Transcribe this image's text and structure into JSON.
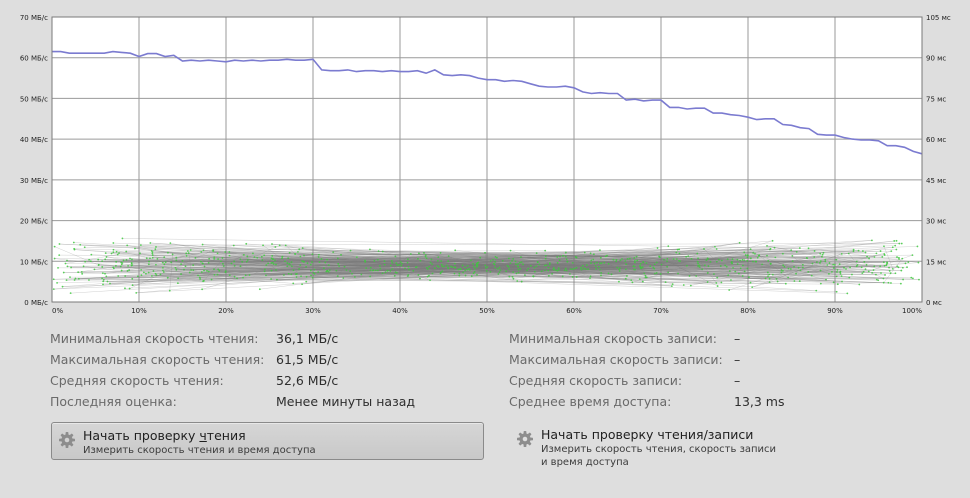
{
  "chart_data": {
    "type": "line",
    "x_unit": "%",
    "y_left": {
      "unit": "МБ/с",
      "ylim": [
        0,
        70
      ],
      "ticks": [
        "0 МБ/с",
        "10 МБ/с",
        "20 МБ/с",
        "30 МБ/с",
        "40 МБ/с",
        "50 МБ/с",
        "60 МБ/с",
        "70 МБ/с"
      ]
    },
    "y_right": {
      "unit": "мс",
      "ylim": [
        0,
        105
      ],
      "ticks": [
        "0 мс",
        "15 мс",
        "30 мс",
        "45 мс",
        "60 мс",
        "75 мс",
        "90 мс",
        "105 мс"
      ]
    },
    "x_ticks": [
      "0%",
      "10%",
      "20%",
      "30%",
      "40%",
      "50%",
      "60%",
      "70%",
      "80%",
      "90%",
      "100%"
    ],
    "grid": true,
    "colors": {
      "read": "#7b7bd0",
      "access": "#3ec93e",
      "access_lines": "#7a7a7a",
      "background": "#ffffff",
      "grid": "#9a9a9a"
    },
    "series": [
      {
        "x": [
          0,
          1,
          2,
          3,
          4,
          5,
          6,
          7,
          8,
          9,
          10,
          11,
          12,
          13,
          14,
          15,
          16,
          17,
          18,
          19,
          20,
          21,
          22,
          23,
          24,
          25,
          26,
          27,
          28,
          29,
          30,
          31,
          32,
          33,
          34,
          35,
          36,
          37,
          38,
          39,
          40,
          41,
          42,
          43,
          44,
          45,
          46,
          47,
          48,
          49,
          50,
          51,
          52,
          53,
          54,
          55,
          56,
          57,
          58,
          59,
          60,
          61,
          62,
          63,
          64,
          65,
          66,
          67,
          68,
          69,
          70,
          71,
          72,
          73,
          74,
          75,
          76,
          77,
          78,
          79,
          80,
          81,
          82,
          83,
          84,
          85,
          86,
          87,
          88,
          89,
          90,
          91,
          92,
          93,
          94,
          95,
          96,
          97,
          98,
          99,
          100
        ],
        "values": [
          61.5,
          61.5,
          61.1,
          61.1,
          61.1,
          61.1,
          61.1,
          61.5,
          61.3,
          61.1,
          60.3,
          61.0,
          61.0,
          60.3,
          60.6,
          59.2,
          59.4,
          59.2,
          59.4,
          59.2,
          59.0,
          59.4,
          59.2,
          59.4,
          59.2,
          59.4,
          59.4,
          59.6,
          59.4,
          59.4,
          59.6,
          57.0,
          56.8,
          56.8,
          57.0,
          56.6,
          56.8,
          56.8,
          56.6,
          56.8,
          56.6,
          56.6,
          56.8,
          56.2,
          57.0,
          55.8,
          55.6,
          55.8,
          55.6,
          55.0,
          54.6,
          54.6,
          54.2,
          54.4,
          54.2,
          53.6,
          53.0,
          52.8,
          52.8,
          53.0,
          52.6,
          51.6,
          51.2,
          51.4,
          51.2,
          51.2,
          49.6,
          49.8,
          49.4,
          49.6,
          49.6,
          47.8,
          47.8,
          47.4,
          47.6,
          47.6,
          46.4,
          46.4,
          46.0,
          45.8,
          45.4,
          44.8,
          45.0,
          45.0,
          43.6,
          43.4,
          42.8,
          42.6,
          41.2,
          41.0,
          41.0,
          40.4,
          40.0,
          39.8,
          39.8,
          39.6,
          38.4,
          38.4,
          38.0,
          37.0,
          36.4
        ]
      }
    ]
  },
  "stats_left": [
    {
      "label": "Минимальная скорость чтения:",
      "value": "36,1 МБ/с"
    },
    {
      "label": "Максимальная скорость чтения:",
      "value": "61,5 МБ/с"
    },
    {
      "label": "Средняя скорость чтения:",
      "value": "52,6 МБ/с"
    },
    {
      "label": "Последняя оценка:",
      "value": "Менее минуты назад"
    }
  ],
  "stats_right": [
    {
      "label": "Минимальная скорость записи:",
      "value": "–"
    },
    {
      "label": "Максимальная скорость записи:",
      "value": "–"
    },
    {
      "label": "Средняя скорость записи:",
      "value": "–"
    },
    {
      "label": "Среднее время доступа:",
      "value": "13,3 ms"
    }
  ],
  "actions": {
    "read": {
      "title_before": "Начать проверку ",
      "title_mnemonic": "ч",
      "title_after": "тения",
      "description": "Измерить скорость чтения и время доступа",
      "icon": "gear-icon"
    },
    "readwrite": {
      "title": "Начать проверку чтения/записи",
      "description_line1": "Измерить скорость чтения, скорость записи",
      "description_line2": "и время доступа",
      "icon": "gear-icon"
    }
  }
}
